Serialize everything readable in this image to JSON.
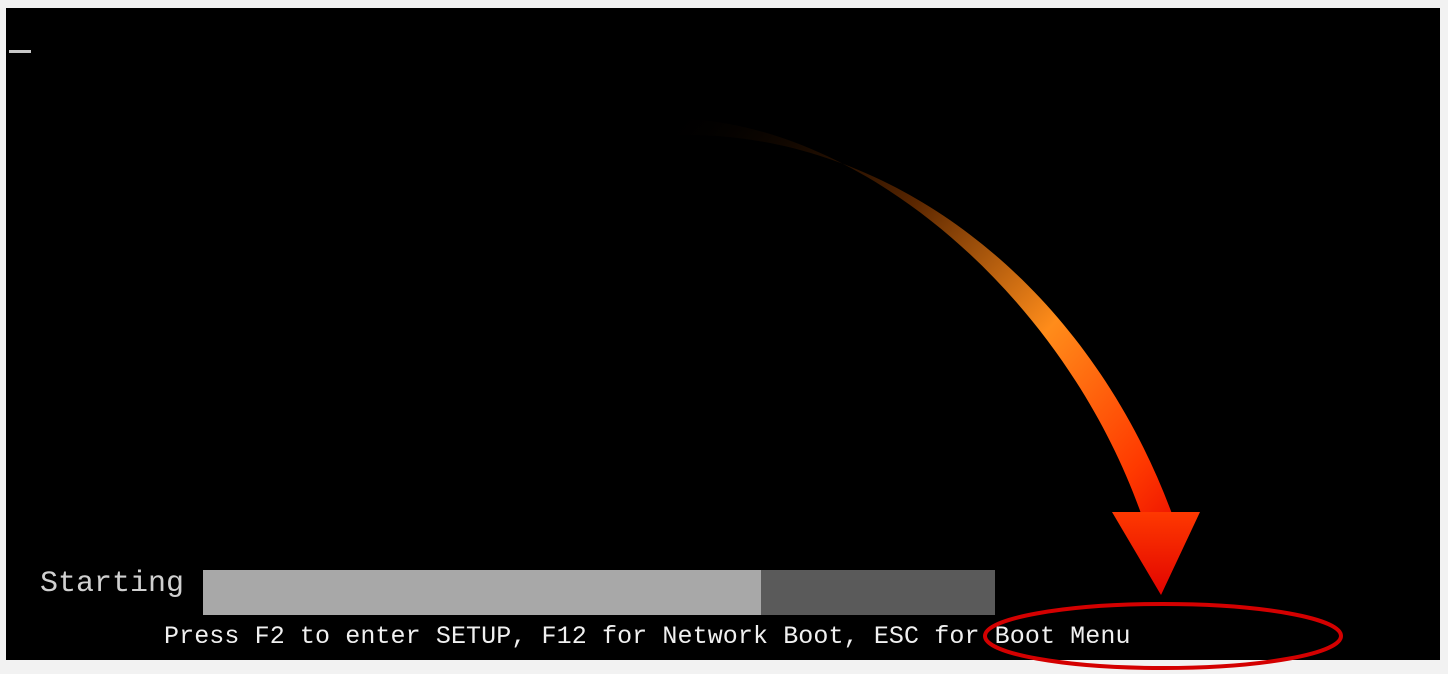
{
  "screen": {
    "background": "#000000",
    "cursor_glyph": "_"
  },
  "boot": {
    "status_label": "Starting",
    "progress_fraction": 0.705,
    "progress_fill_color": "#a8a8a8",
    "progress_track_color": "#5a5a5a",
    "prompt_part1": "Press F2 to enter SETUP, F12 for Network Boot, ",
    "prompt_highlight": "ESC for Boot Menu"
  },
  "annotation": {
    "arrow_icon": "curved-arrow-icon",
    "arrow_colors": [
      "#000000",
      "#ff8c1a",
      "#e60000"
    ],
    "highlight_ellipse_color": "#d40000"
  }
}
